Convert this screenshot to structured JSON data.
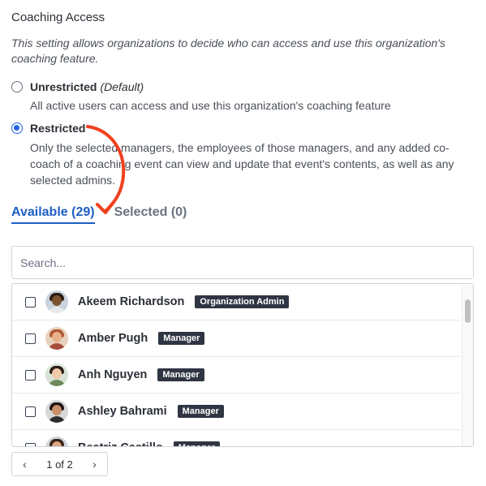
{
  "section": {
    "title": "Coaching Access",
    "description": "This setting allows organizations to decide who can access and use this organization's coaching feature."
  },
  "options": [
    {
      "label": "Unrestricted",
      "suffix": "(Default)",
      "description": "All active users can access and use this organization's coaching feature",
      "selected": false
    },
    {
      "label": "Restricted",
      "suffix": "",
      "description": "Only the selected managers, the employees of those managers, and any added co-coach of a coaching event can view and update that event's contents, as well as any selected admins.",
      "selected": true
    }
  ],
  "tabs": [
    {
      "label": "Available (29)",
      "active": true
    },
    {
      "label": "Selected (0)",
      "active": false
    }
  ],
  "search": {
    "placeholder": "Search...",
    "value": ""
  },
  "users": [
    {
      "name": "Akeem Richardson",
      "role": "Organization Admin",
      "checked": false
    },
    {
      "name": "Amber Pugh",
      "role": "Manager",
      "checked": false
    },
    {
      "name": "Anh Nguyen",
      "role": "Manager",
      "checked": false
    },
    {
      "name": "Ashley Bahrami",
      "role": "Manager",
      "checked": false
    },
    {
      "name": "Beatriz Castillo",
      "role": "Manager",
      "checked": false
    }
  ],
  "pagination": {
    "page_info": "1 of 2",
    "prev_icon": "chevron-left-icon",
    "next_icon": "chevron-right-icon"
  },
  "colors": {
    "accent": "#1d5fc4",
    "radio": "#2563eb",
    "badge": "#2f3542",
    "arrow": "#f0401e"
  }
}
